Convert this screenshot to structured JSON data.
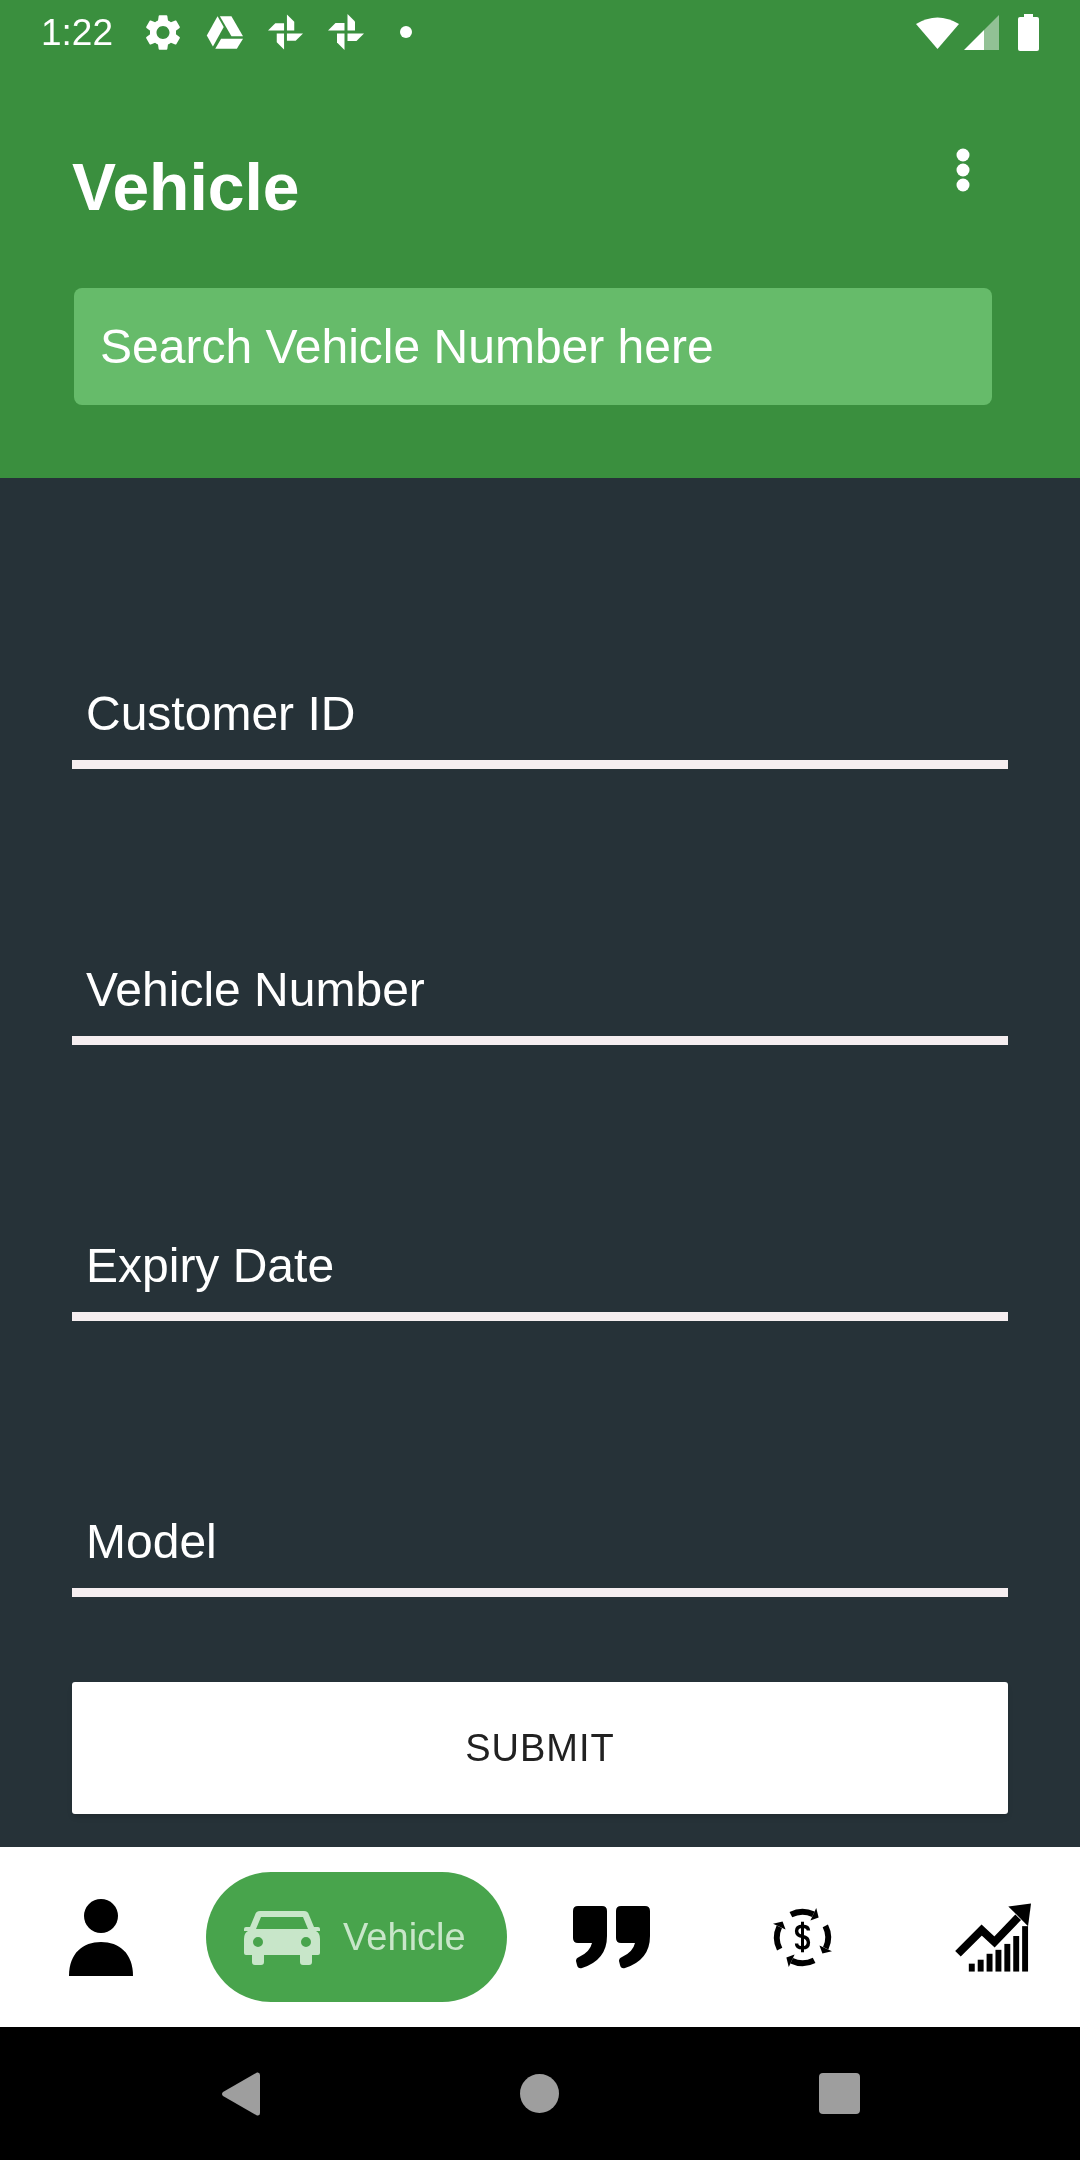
{
  "status_bar": {
    "time": "1:22"
  },
  "toolbar": {
    "title": "Vehicle"
  },
  "search": {
    "placeholder": "Search Vehicle Number here"
  },
  "form": {
    "fields": [
      {
        "placeholder": "Customer ID"
      },
      {
        "placeholder": "Vehicle Number"
      },
      {
        "placeholder": "Expiry Date"
      },
      {
        "placeholder": "Model"
      }
    ],
    "submit": "SUBMIT"
  },
  "bottom_nav": {
    "items": [
      {
        "selected": false
      },
      {
        "label": "Vehicle",
        "selected": true
      },
      {
        "selected": false
      },
      {
        "selected": false
      },
      {
        "selected": false
      }
    ]
  }
}
